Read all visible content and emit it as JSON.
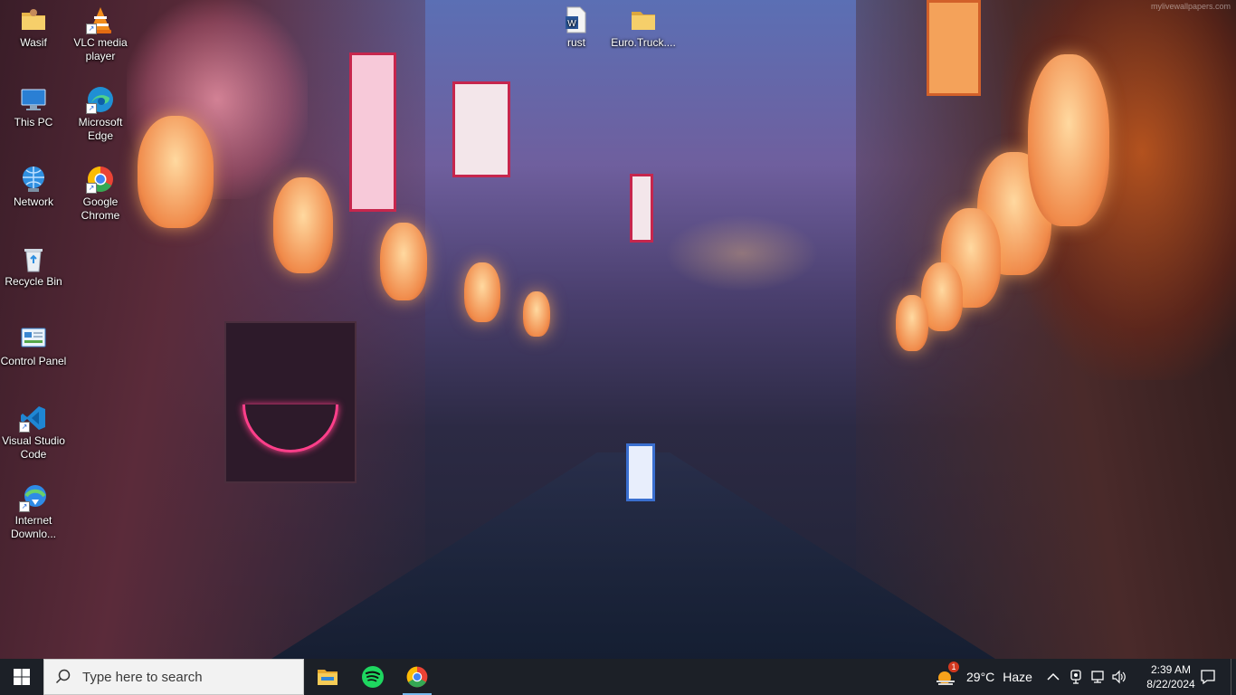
{
  "desktop": {
    "watermark": "mylivewallpapers.com",
    "icons": [
      {
        "label": "Wasif",
        "icon": "user-folder-icon"
      },
      {
        "label": "VLC media player",
        "icon": "vlc-icon"
      },
      {
        "label": "rust",
        "icon": "word-document-icon"
      },
      {
        "label": "Euro.Truck....",
        "icon": "folder-icon"
      },
      {
        "label": "This PC",
        "icon": "computer-icon"
      },
      {
        "label": "Microsoft Edge",
        "icon": "edge-icon"
      },
      {
        "label": "Network",
        "icon": "network-icon"
      },
      {
        "label": "Google Chrome",
        "icon": "chrome-icon"
      },
      {
        "label": "Recycle Bin",
        "icon": "recycle-bin-icon"
      },
      {
        "label": "Control Panel",
        "icon": "control-panel-icon"
      },
      {
        "label": "Visual Studio Code",
        "icon": "vscode-icon"
      },
      {
        "label": "Internet Downlo...",
        "icon": "internet-download-manager-icon"
      }
    ]
  },
  "taskbar": {
    "search_placeholder": "Type here to search",
    "pinned": [
      {
        "name": "File Explorer",
        "icon": "file-explorer-icon"
      },
      {
        "name": "Spotify",
        "icon": "spotify-icon"
      },
      {
        "name": "Google Chrome",
        "icon": "chrome-icon",
        "active": true
      }
    ],
    "weather": {
      "badge": "1",
      "temperature": "29°C",
      "condition": "Haze"
    },
    "clock": {
      "time": "2:39 AM",
      "date": "8/22/2024"
    }
  },
  "colors": {
    "taskbar_bg": "#1c2027",
    "spotify_green": "#1ed760",
    "chrome_red": "#ea4335",
    "chrome_yellow": "#fbbc05",
    "chrome_green": "#34a853",
    "chrome_blue": "#4285f4",
    "windows_blue": "#00a4ef"
  }
}
